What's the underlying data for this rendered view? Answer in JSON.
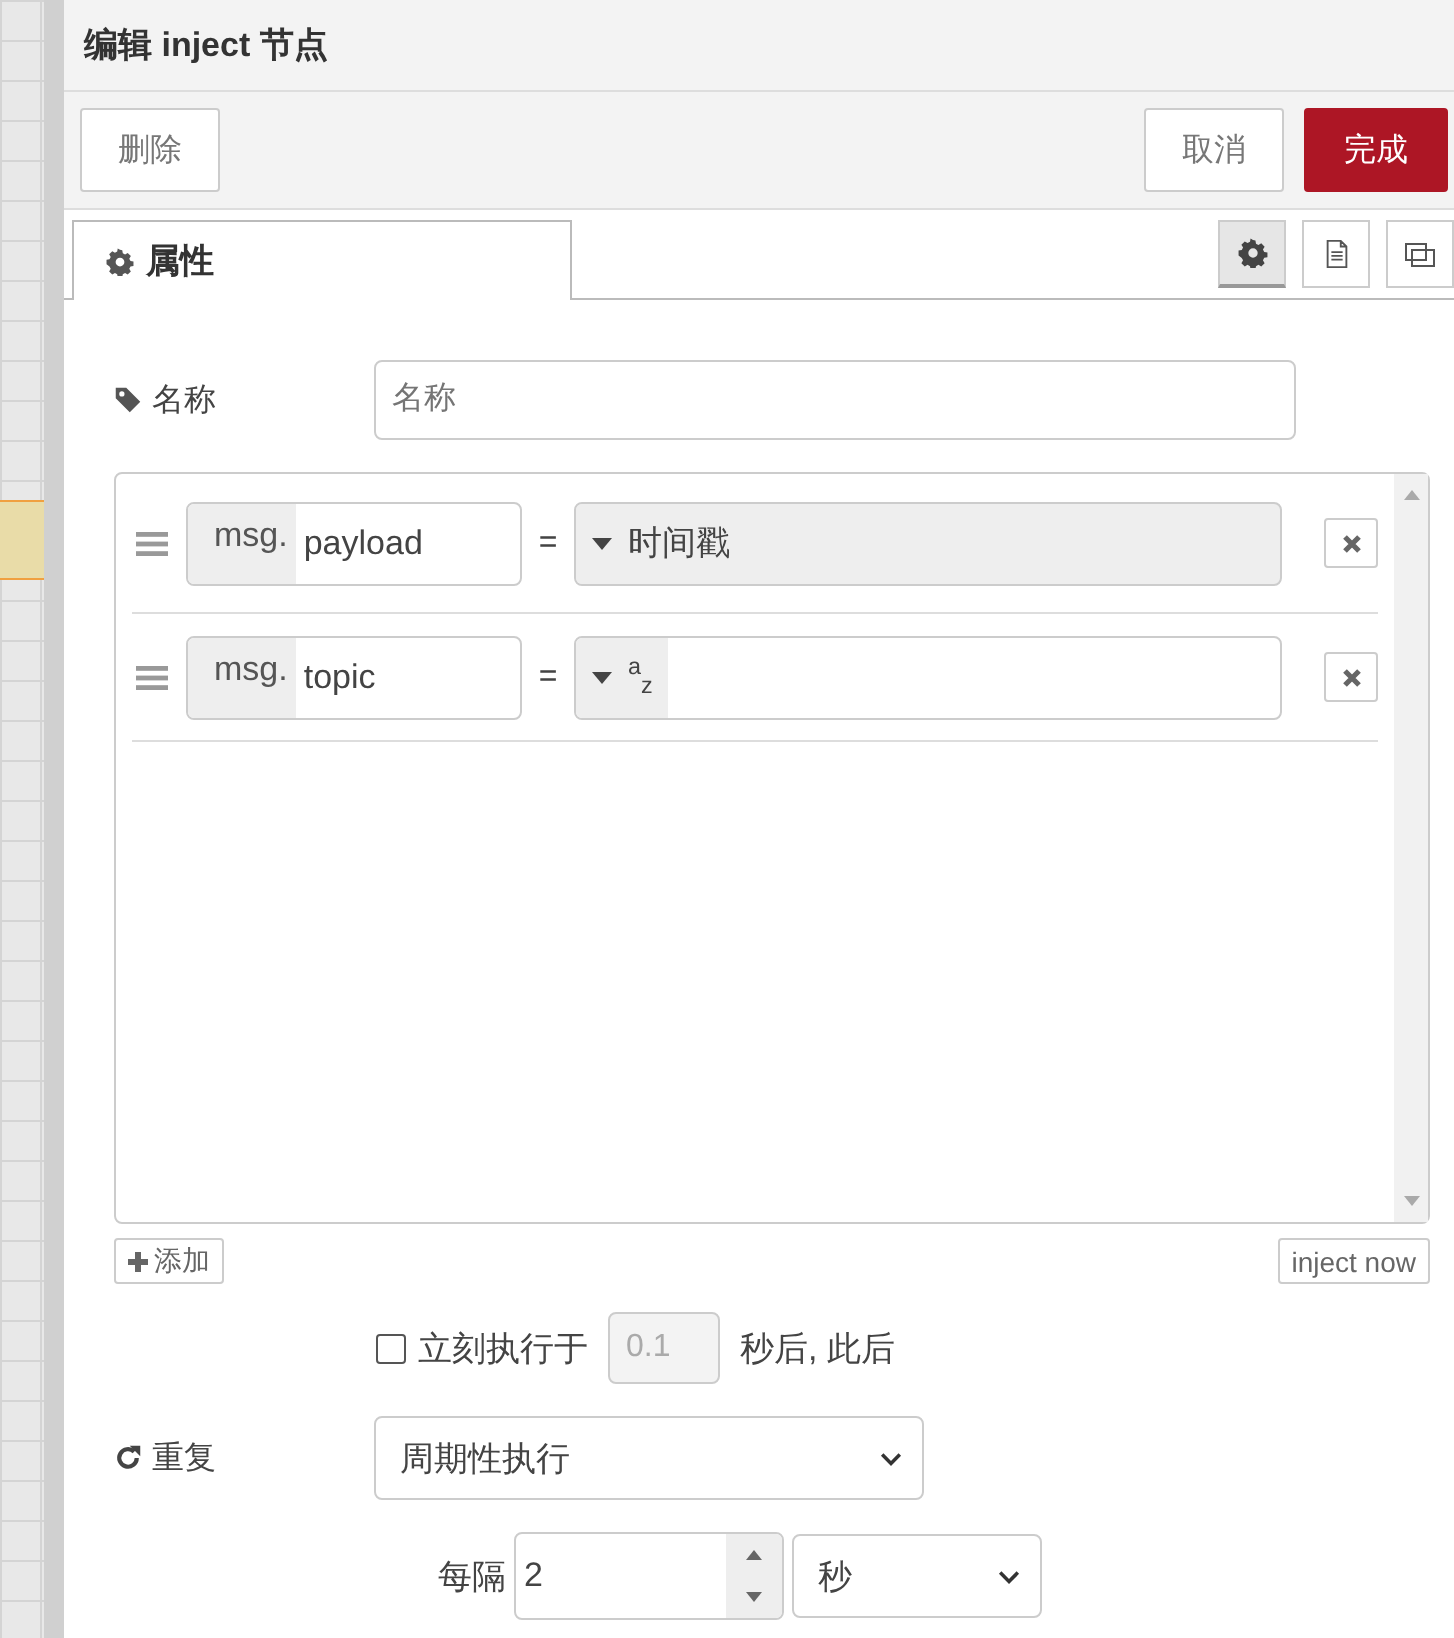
{
  "dialog": {
    "title": "编辑 inject 节点"
  },
  "buttons": {
    "delete": "删除",
    "cancel": "取消",
    "done": "完成"
  },
  "tabs": [
    {
      "label": "属性",
      "selected": true
    }
  ],
  "tab_tools": [
    {
      "kind": "settings",
      "selected": true
    },
    {
      "kind": "description",
      "selected": false
    },
    {
      "kind": "appearance",
      "selected": false
    }
  ],
  "name_field": {
    "label": "名称",
    "placeholder": "名称"
  },
  "properties": [
    {
      "prefix": "msg.",
      "key": "payload",
      "operator": "=",
      "kind": "timestamp",
      "type_label": "时间戳"
    },
    {
      "prefix": "msg.",
      "key": "topic",
      "operator": "=",
      "kind": "string",
      "type_label": "$^{a}$$_{z}$"
    }
  ],
  "add_button": "添加",
  "inject_button": "inject now",
  "once": {
    "checked": false,
    "label": "立刻执行于",
    "delay": "0.1",
    "disabled": true,
    "suffix": "秒后, 此后"
  },
  "repeat": {
    "label": "重复",
    "value": "周期性执行"
  },
  "interval": {
    "label": "每隔",
    "value": "2",
    "unit": "秒"
  }
}
